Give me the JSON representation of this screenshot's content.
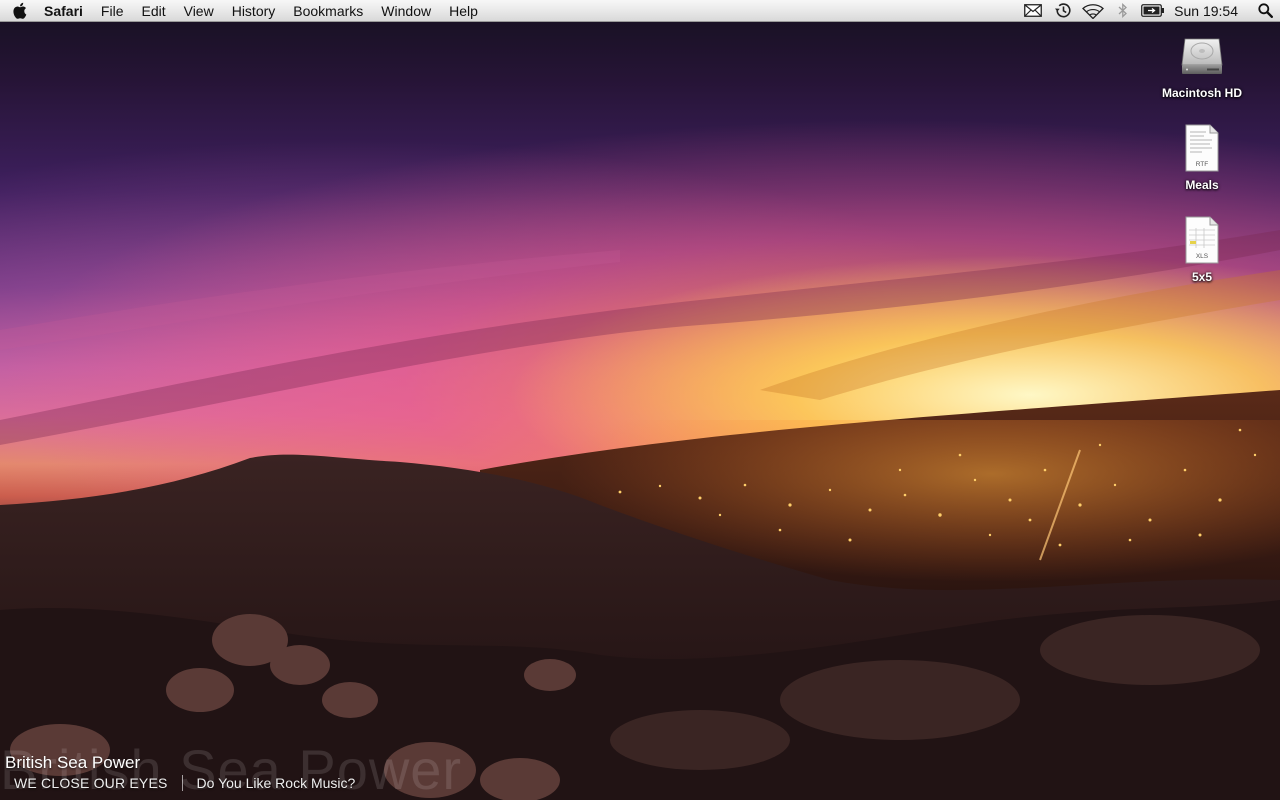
{
  "menubar": {
    "app_name": "Safari",
    "menus": [
      "File",
      "Edit",
      "View",
      "History",
      "Bookmarks",
      "Window",
      "Help"
    ],
    "status_icons": [
      "mail-icon",
      "time-machine-icon",
      "wifi-icon",
      "bluetooth-icon",
      "battery-icon"
    ],
    "clock": "Sun 19:54"
  },
  "desktop": {
    "icons": [
      {
        "label": "Macintosh HD",
        "type": "hard-drive-icon"
      },
      {
        "label": "Meals",
        "type": "rtf-document-icon",
        "badge": "RTF"
      },
      {
        "label": "5x5",
        "type": "xls-document-icon",
        "badge": "XLS"
      }
    ]
  },
  "now_playing": {
    "artist": "British Sea Power",
    "album": "WE CLOSE OUR EYES",
    "track": "Do You Like Rock Music?",
    "ghost_text": "British Sea Power"
  }
}
